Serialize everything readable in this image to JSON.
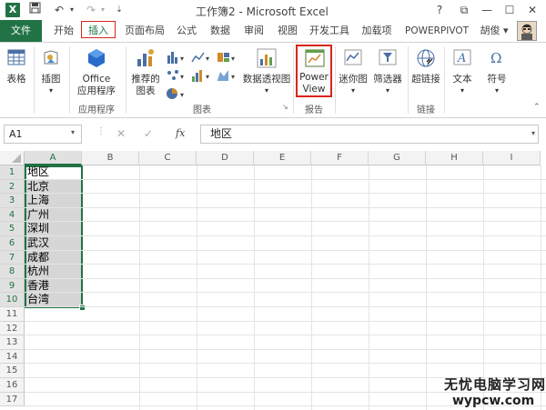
{
  "window": {
    "title": "工作簿2 - Microsoft Excel",
    "logo": "X",
    "username": "胡俊",
    "controls": {
      "help": "?",
      "restore": "⧉",
      "minimize": "—",
      "maximize": "☐",
      "close": "✕"
    }
  },
  "tabs": [
    "文件",
    "开始",
    "插入",
    "页面布局",
    "公式",
    "数据",
    "审阅",
    "视图",
    "开发工具",
    "加载项",
    "POWERPIVOT"
  ],
  "ribbon": {
    "groups": [
      {
        "label": "",
        "buttons": [
          "表格"
        ]
      },
      {
        "label": "",
        "buttons": [
          "插图"
        ]
      },
      {
        "label": "应用程序",
        "buttons": [
          "Office 应用程序"
        ]
      },
      {
        "label": "图表",
        "buttons": [
          "推荐的图表"
        ]
      },
      {
        "label": "报告",
        "buttons": [
          "数据透视图",
          "Power View"
        ]
      },
      {
        "label": "",
        "buttons": [
          "迷你图",
          "筛选器"
        ]
      },
      {
        "label": "链接",
        "buttons": [
          "超链接"
        ]
      },
      {
        "label": "",
        "buttons": [
          "文本",
          "符号"
        ]
      }
    ],
    "office_line1": "Office",
    "office_line2": "应用程序",
    "rec_line1": "推荐的",
    "rec_line2": "图表",
    "pv_line1": "Power",
    "pv_line2": "View"
  },
  "formula_bar": {
    "name_box": "A1",
    "fx": "fx",
    "cancel": "✕",
    "enter": "✓",
    "content": "地区"
  },
  "columns": [
    "A",
    "B",
    "C",
    "D",
    "E",
    "F",
    "G",
    "H",
    "I"
  ],
  "rows": [
    "1",
    "2",
    "3",
    "4",
    "5",
    "6",
    "7",
    "8",
    "9",
    "10",
    "11",
    "12",
    "13",
    "14",
    "15",
    "16",
    "17"
  ],
  "cells_a": [
    "地区",
    "北京",
    "上海",
    "广州",
    "深圳",
    "武汉",
    "成都",
    "杭州",
    "香港",
    "台湾"
  ],
  "watermark": {
    "line1": "无忧电脑学习网",
    "line2": "wypcw.com"
  },
  "colors": {
    "excel_green": "#217346",
    "highlight_red": "#d9261c",
    "selection_gray": "#d6d6d6"
  }
}
